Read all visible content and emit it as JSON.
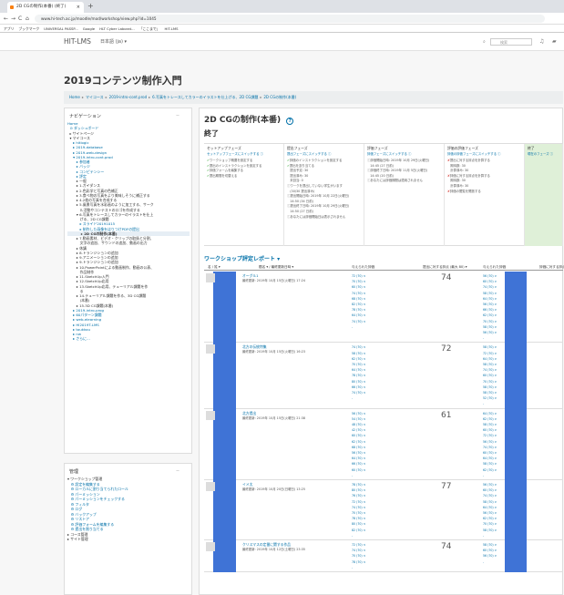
{
  "browser": {
    "tab_title": "2D CGの制作(本番) (終了)",
    "close_glyph": "×",
    "new_tab": "+",
    "nav_back": "←",
    "nav_forward": "→",
    "nav_reload": "C",
    "nav_home": "⌂",
    "url": "www.hi-tech.ac.jp/moodle/mod/workshop/view.php?id=1045",
    "bookmarks": [
      "アプリ",
      "ブックマーク",
      "UNIVERSAL PASSP...",
      "Google",
      "HLT Cyber Laborat...",
      "「ここまで」",
      "HIT-LMS"
    ]
  },
  "navbar": {
    "brand": "HIT-LMS",
    "lang": "日本語 (ja) ▾",
    "search_placeholder": "検索"
  },
  "page": {
    "course_title": "2019コンテンツ制作入門",
    "breadcrumb": [
      "Home",
      "マイコース",
      "2019-intro-cont.prod",
      "6.写真をトレースしてカラーのイラストを仕上げる、2D CG課題",
      "2D CGの制作(本番)"
    ]
  },
  "nav_block": {
    "title": "ナビゲーション",
    "hide": "ー",
    "items": [
      {
        "text": "Home",
        "cls": ""
      },
      {
        "text": "  ⊙ ダッシュボード",
        "cls": ""
      },
      {
        "text": "  ▸ サイトページ",
        "cls": "dark"
      },
      {
        "text": "  ▾ マイコース",
        "cls": "dark"
      },
      {
        "text": "     ▸ hitlogic",
        "cls": ""
      },
      {
        "text": "     ▸ 2019-database",
        "cls": ""
      },
      {
        "text": "     ▸ 2019-web-design",
        "cls": ""
      },
      {
        "text": "     ▾ 2019-intro-cont.prod",
        "cls": ""
      },
      {
        "text": "        ▸ 参加者",
        "cls": ""
      },
      {
        "text": "        ▸ バッジ",
        "cls": ""
      },
      {
        "text": "        ▸ コンピテンシー",
        "cls": ""
      },
      {
        "text": "        ▸ 評定",
        "cls": ""
      },
      {
        "text": "        ▸ 一般",
        "cls": "dark"
      },
      {
        "text": "        ▸ 1.ガイダンス",
        "cls": "dark"
      },
      {
        "text": "        ▸ 2.色彩学と写真の色補正",
        "cls": "dark"
      },
      {
        "text": "        ▸ 3.食べ物の写真をより美味しそうに補正する",
        "cls": "dark"
      },
      {
        "text": "        ▸ 4.2枚の写真を合成する",
        "cls": "dark"
      },
      {
        "text": "        ▸ 5.風景写真を水彩画のように加工する、サーク",
        "cls": "dark"
      },
      {
        "text": "           ル活動やコンテストのロゴを作成する",
        "cls": "dark"
      },
      {
        "text": "        ▾ 6.写真をトレースしてカラーのイラストを仕上",
        "cls": "dark"
      },
      {
        "text": "           げる、2D CG課題",
        "cls": "dark"
      },
      {
        "text": "           ▸ スライド20191015",
        "cls": ""
      },
      {
        "text": "           ▸ 制作した画像をはりつけPDFの提出",
        "cls": ""
      },
      {
        "text": "           ▸ 2D CGの制作(本番)",
        "cls": "sel"
      },
      {
        "text": "        ▸ 7.動画素材、ビデオ・クリップの取扱と分割、",
        "cls": "dark"
      },
      {
        "text": "           文字の追加、サウンドの追加、動画の出力",
        "cls": "dark"
      },
      {
        "text": "        ▸ 休講",
        "cls": "dark"
      },
      {
        "text": "        ▸ 8.トランジションの追加",
        "cls": "dark"
      },
      {
        "text": "        ▸ 9.アニメーションの追加",
        "cls": "dark"
      },
      {
        "text": "        ▸ 9.トランジションの追加",
        "cls": "dark"
      },
      {
        "text": "        ▸ 10.PowerPointによる動画制作、動画の公表、",
        "cls": "dark"
      },
      {
        "text": "           作品制作",
        "cls": "dark"
      },
      {
        "text": "        ▸ 11.SketchUp入門",
        "cls": "dark"
      },
      {
        "text": "        ▸ 12.SketchUp応用",
        "cls": "dark"
      },
      {
        "text": "        ▸ 13.SketchUp応用、テューリアル課題を作",
        "cls": "dark"
      },
      {
        "text": "           る",
        "cls": "dark"
      },
      {
        "text": "        ▸ 14.テューリアル課題を作る、3D CG課題",
        "cls": "dark"
      },
      {
        "text": "           (本番)",
        "cls": "dark"
      },
      {
        "text": "        ▸ 15.3D CG課題(本番)",
        "cls": "dark"
      },
      {
        "text": "     ▸ 2019-intro-prog",
        "cls": ""
      },
      {
        "text": "     ▸ 60パターン課題",
        "cls": ""
      },
      {
        "text": "     ▸ web-elearning",
        "cls": ""
      },
      {
        "text": "     ▸ HI2019T-LMS",
        "cls": ""
      },
      {
        "text": "     ▸ toukkou",
        "cls": ""
      },
      {
        "text": "     ▸ nw",
        "cls": ""
      },
      {
        "text": "     ▸ さらに…",
        "cls": ""
      }
    ]
  },
  "admin_block": {
    "title": "管理",
    "hide": "ー",
    "items": [
      {
        "text": "▾ ワークショップ管理",
        "cls": "dark"
      },
      {
        "text": "   ⚙ 設定を編集する",
        "cls": ""
      },
      {
        "text": "   ⚙ ローカルに割り当てられたロール",
        "cls": ""
      },
      {
        "text": "   ⚙ パーミッション",
        "cls": ""
      },
      {
        "text": "   ⚙ パーミッションをチェックする",
        "cls": ""
      },
      {
        "text": "   ⚙ フィルタ",
        "cls": ""
      },
      {
        "text": "   ⚙ ログ",
        "cls": ""
      },
      {
        "text": "   ⚙ バックアップ",
        "cls": ""
      },
      {
        "text": "   ⚙ リストア",
        "cls": ""
      },
      {
        "text": "   ⚙ 評価フォームを編集する",
        "cls": ""
      },
      {
        "text": "   ⚙ 提出を割り当てる",
        "cls": ""
      },
      {
        "text": "▸ コース管理",
        "cls": "dark"
      },
      {
        "text": "▸ サイト管理",
        "cls": "dark"
      }
    ]
  },
  "main": {
    "title": "2D CGの制作(本番)",
    "help_icon": "?",
    "phase_title": "終了",
    "phases": [
      {
        "name": "セットアップフェーズ",
        "link": "セットアップフェーズにスイッチする ⓘ",
        "tasks": [
          {
            "mark": "✔",
            "k": "ck",
            "text": "ワークショップ概要を設定する"
          },
          {
            "mark": "✔",
            "k": "ck",
            "text": "提出のインストラクションを設定する"
          },
          {
            "mark": "✔",
            "k": "ck",
            "text": "評価フォームを編集する"
          },
          {
            "mark": "✔",
            "k": "ck",
            "text": "提出期間を切替える"
          }
        ]
      },
      {
        "name": "提出フェーズ",
        "link": "提出フェーズにスイッチする ⓘ",
        "tasks": [
          {
            "mark": "✔",
            "k": "ck",
            "text": "評価のインストラクションを設定する"
          },
          {
            "mark": "✔",
            "k": "ck",
            "text": "提出を割り当てる"
          },
          {
            "mark": "",
            "k": "inf",
            "text": "   提出予定: 30"
          },
          {
            "mark": "",
            "k": "inf",
            "text": "   提出済み: 30"
          },
          {
            "mark": "",
            "k": "inf",
            "text": "   未割当: 0"
          },
          {
            "mark": "ⓘ",
            "k": "inf",
            "text": "ワークを提出していない学生がいます"
          },
          {
            "mark": "",
            "k": "inf",
            "text": "   (30/30 提出済み)"
          },
          {
            "mark": "ⓘ",
            "k": "inf",
            "text": "提出開始日時: 2019年 10月 22日(火曜日)"
          },
          {
            "mark": "",
            "k": "inf",
            "text": "   14:50 (34 日前)"
          },
          {
            "mark": "ⓘ",
            "k": "inf",
            "text": "提出終了日時: 2019年 10月 29日(火曜日)"
          },
          {
            "mark": "",
            "k": "inf",
            "text": "   14:50 (27 日前)"
          },
          {
            "mark": "ⓘ",
            "k": "inf",
            "text": "あなたには評価開始日は表示されません"
          }
        ]
      },
      {
        "name": "評価フェーズ",
        "link": "評価フェーズにスイッチする ⓘ",
        "tasks": [
          {
            "mark": "ⓘ",
            "k": "inf",
            "text": "評価開始日時: 2019年 10月 29日(火曜日)"
          },
          {
            "mark": "",
            "k": "inf",
            "text": "   14:45 (27 日前)"
          },
          {
            "mark": "ⓘ",
            "k": "inf",
            "text": "評価終了日時: 2019年 11月 5日(火曜日)"
          },
          {
            "mark": "",
            "k": "inf",
            "text": "   14:45 (20 日前)"
          },
          {
            "mark": "ⓘ",
            "k": "inf",
            "text": "あなたには評価期間は適用されません"
          }
        ]
      },
      {
        "name": "評価の評価フェーズ",
        "link": "評価の評価フェーズにスイッチする ⓘ",
        "tasks": [
          {
            "mark": "✘",
            "k": "xx",
            "text": "提出に対する評点を計算する"
          },
          {
            "mark": "",
            "k": "inf",
            "text": "   期待数: 30"
          },
          {
            "mark": "",
            "k": "inf",
            "text": "   計算済み: 30"
          },
          {
            "mark": "✘",
            "k": "xx",
            "text": "評価に対する評点を計算する"
          },
          {
            "mark": "",
            "k": "inf",
            "text": "   期待数: 30"
          },
          {
            "mark": "",
            "k": "inf",
            "text": "   計算済み: 30"
          },
          {
            "mark": "✘",
            "k": "xx",
            "text": "評価の閲覧を開放する"
          }
        ]
      },
      {
        "name": "終了",
        "link": "現在のフェーズ ⓘ",
        "tasks": []
      }
    ],
    "report_title": "ワークショップ評定レポート ▾",
    "columns": [
      "名 / 姓 ▾",
      "題名 ▾ / 最終更新日時 ▾",
      "与えられた評価",
      "提出に対する評点 (最大 80) ▾",
      "与えられた評価",
      "評価に対する評点"
    ],
    "rows": [
      {
        "name": "オーグル1",
        "desc": "最終更新: 2019年 10月 15日(火曜日) 17:24",
        "score": "74",
        "g1": [
          "72 (70) <",
          "70 (70) <",
          "60 (70) <",
          "74 (70) <",
          "68 (70) <",
          "82 (70) <",
          "78 (70) <",
          "64 (70) <",
          "74 (70) <",
          "-"
        ],
        "g2": [
          "56 (70) >",
          "60 (70) >",
          "74 (70) >",
          "58 (70) >",
          "64 (70) >",
          "56 (70) >",
          "66 (70) >",
          "62 (70) >",
          "70 (70) >",
          "58 (70) >",
          "56 (70) >",
          "-"
        ]
      },
      {
        "name": "北方の伝統特集",
        "desc": "最終更新: 2019年 10月 15日(火曜日) 16:23",
        "score": "72",
        "g1": [
          "74 (70) <",
          "58 (70) <",
          "62 (70) <",
          "70 (70) <",
          "64 (70) <",
          "78 (70) <",
          "80 (70) <",
          "66 (70) <",
          "74 (70) <",
          "-"
        ],
        "g2": [
          "58 (70) >",
          "72 (70) >",
          "64 (70) >",
          "58 (70) >",
          "74 (70) >",
          "60 (70) >",
          "70 (70) >",
          "58 (70) >",
          "58 (70) >",
          "52 (70) >",
          "-"
        ]
      },
      {
        "name": "北方提出",
        "desc": "最終更新: 2019年 10月 15日(火曜日) 21:38",
        "score": "61",
        "g1": [
          "56 (70) <",
          "54 (70) <",
          "48 (70) <",
          "42 (70) <",
          "60 (70) <",
          "62 (70) <",
          "68 (70) <",
          "56 (70) <",
          "64 (70) <",
          "66 (70) <",
          "60 (70) <",
          "-"
        ],
        "g2": [
          "64 (70) >",
          "62 (70) >",
          "58 (70) >",
          "60 (70) >",
          "72 (70) >",
          "56 (70) >",
          "74 (70) >",
          "60 (70) >",
          "64 (70) >",
          "58 (70) >",
          "62 (70) >",
          "-"
        ]
      },
      {
        "name": "イメ太",
        "desc": "最終更新: 2019年 10月 20日(日曜日) 13:25",
        "score": "77",
        "g1": [
          "78 (70) <",
          "80 (70) <",
          "76 (70) <",
          "72 (70) <",
          "74 (70) <",
          "70 (70) <",
          "78 (70) <",
          "80 (70) <",
          "82 (70) <",
          "-"
        ],
        "g2": [
          "56 (70) >",
          "60 (70) >",
          "74 (70) >",
          "58 (70) >",
          "64 (70) >",
          "56 (70) >",
          "62 (70) >",
          "70 (70) >",
          "58 (70) >",
          "-"
        ]
      },
      {
        "name": "クリスマスの定番に関する作品",
        "desc": "最終更新: 2019年 10月 12日(土曜日) 23:35",
        "score": "74",
        "g1": [
          "72 (70) <",
          "74 (70) <",
          "70 (70) <",
          "78 (70) <",
          "-"
        ],
        "g2": [
          "58 (70) >",
          "60 (70) >",
          "56 (70) >",
          "-"
        ]
      }
    ]
  }
}
